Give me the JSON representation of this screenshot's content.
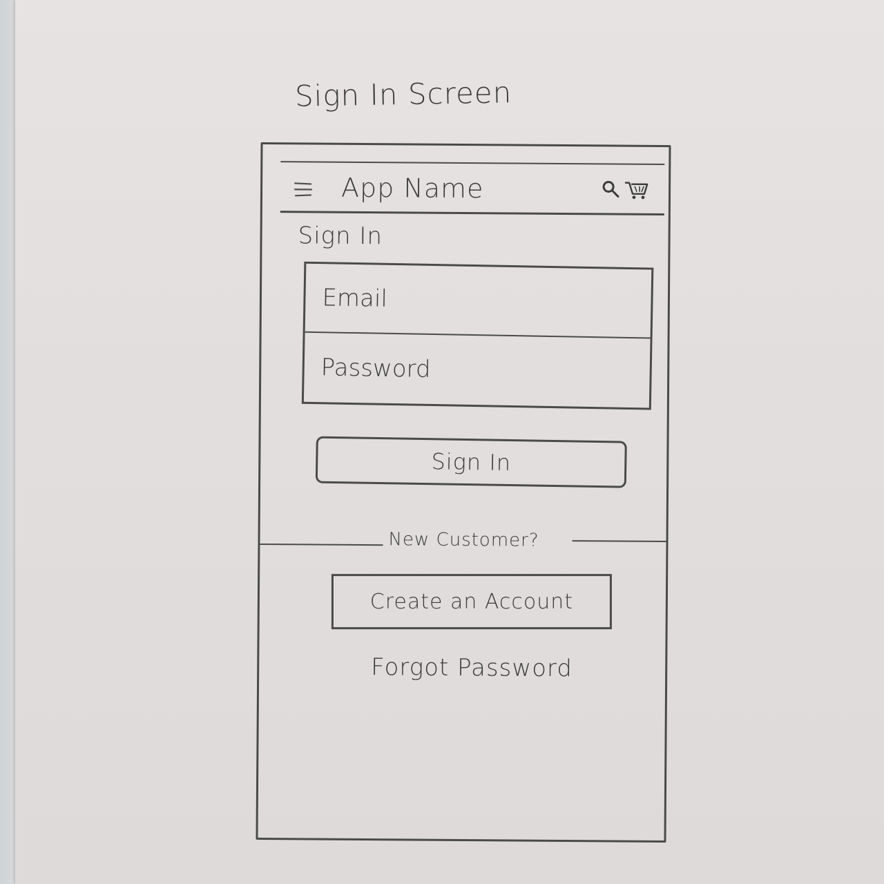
{
  "sketch": {
    "title": "Sign In Screen"
  },
  "app_bar": {
    "app_name": "App Name",
    "icons": [
      "menu-icon",
      "search-icon",
      "cart-icon"
    ]
  },
  "sign_in": {
    "heading": "Sign In",
    "email_placeholder": "Email",
    "password_placeholder": "Password",
    "submit_label": "Sign In"
  },
  "new_customer": {
    "divider_label": "New Customer?",
    "create_account_label": "Create an Account"
  },
  "forgot_password": {
    "label": "Forgot Password"
  },
  "colors": {
    "pencil": "#4a4a4a",
    "paper": "#e4e0df"
  }
}
